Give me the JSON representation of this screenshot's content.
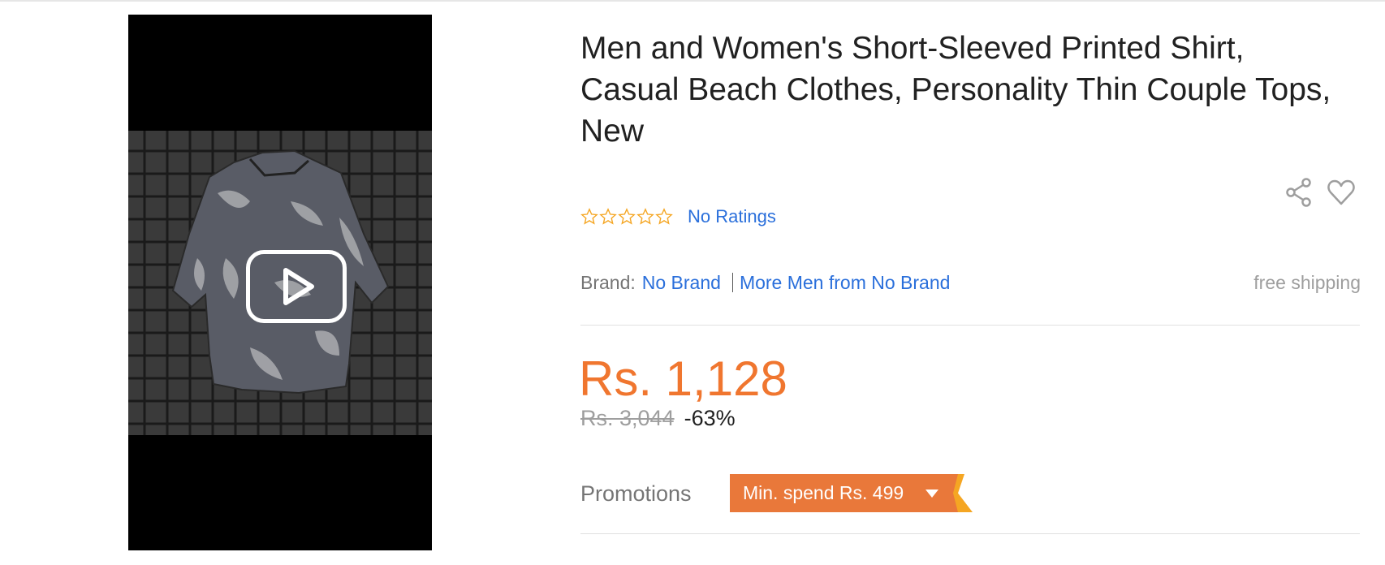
{
  "media": {
    "play_icon": "play-icon",
    "thumbnail": "shirt-image"
  },
  "product": {
    "title": "Men and Women's Short-Sleeved Printed Shirt, Casual Beach Clothes, Personality Thin Couple Tops, New",
    "rating_stars": 0,
    "rating_max": 5,
    "ratings_text": "No Ratings",
    "brand_label": "Brand:",
    "brand_name": "No Brand",
    "more_from": "More Men from No Brand",
    "shipping": "free shipping",
    "price": "Rs. 1,128",
    "original_price": "Rs. 3,044",
    "discount": "-63%",
    "promotions_label": "Promotions",
    "promotion_tag": "Min. spend Rs. 499"
  },
  "icons": {
    "share": "share-icon",
    "wishlist": "heart-icon",
    "star": "star-outline-icon",
    "caret": "caret-down-icon"
  },
  "colors": {
    "price": "#f0762f",
    "link": "#2a6fdb",
    "star": "#f5a623",
    "promo": "#e9783a",
    "promo_tail": "#f5a623"
  }
}
